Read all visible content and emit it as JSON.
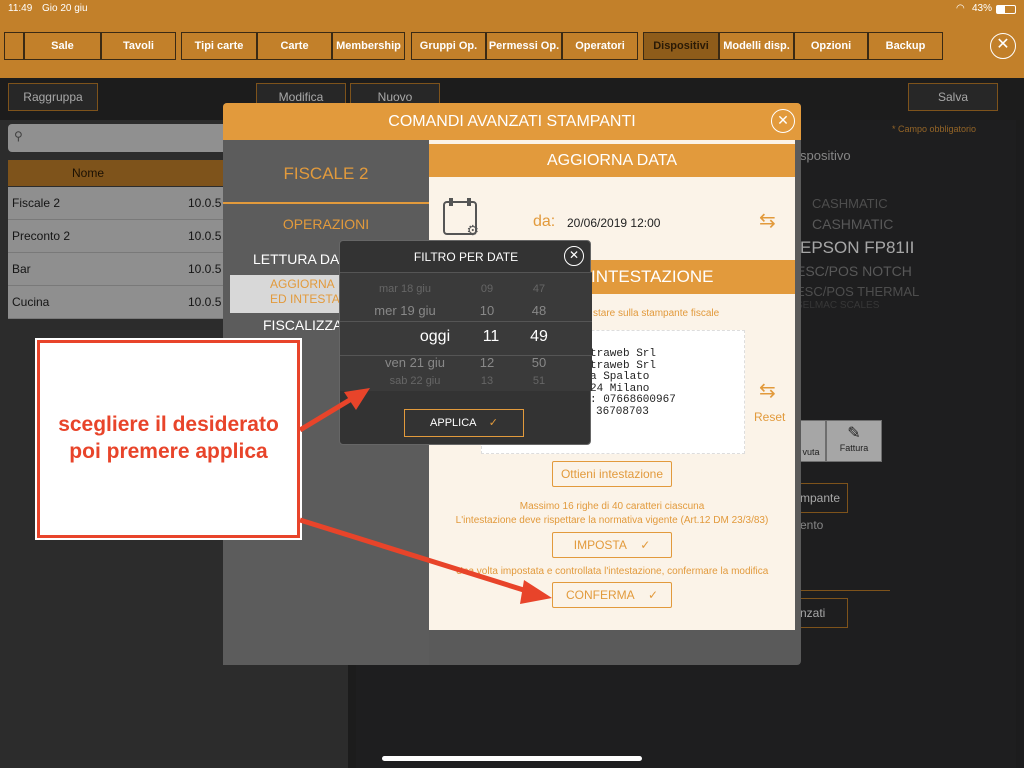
{
  "status": {
    "time": "11:49",
    "date": "Gio 20 giu",
    "battery": "43%"
  },
  "tabs": [
    "Sale",
    "Tavoli",
    "Tipi carte",
    "Carte",
    "Membership",
    "Gruppi Op.",
    "Permessi Op.",
    "Operatori",
    "Dispositivi",
    "Modelli disp.",
    "Opzioni",
    "Backup"
  ],
  "toolbar": {
    "group": "Raggruppa",
    "edit": "Modifica",
    "new": "Nuovo",
    "save": "Salva"
  },
  "list": {
    "header_name": "Nome",
    "rows": [
      {
        "name": "Fiscale 2",
        "ip": "10.0.5"
      },
      {
        "name": "Preconto 2",
        "ip": "10.0.5"
      },
      {
        "name": "Bar",
        "ip": "10.0.5"
      },
      {
        "name": "Cucina",
        "ip": "10.0.5"
      }
    ]
  },
  "right": {
    "required": "* Campo obbligatorio",
    "device_label": "spositivo",
    "models": [
      "CASHMATIC",
      "CASHMATIC",
      "EPSON FP81II",
      "ESC/POS NOTCH",
      "ESC/POS THERMAL",
      "SELMAC SCALES"
    ],
    "receipt_label": "vuta",
    "invoice_label": "Fattura",
    "printer_btn": "mpante",
    "fragment": "ento",
    "adv_btn": "nzati"
  },
  "modal": {
    "title": "COMANDI AVANZATI STAMPANTI",
    "device": "FISCALE 2",
    "operations": "OPERAZIONI",
    "menu": [
      "LETTURA DA",
      "AGGIORNA\nED INTESTA",
      "FISCALIZZA"
    ],
    "update_date_title": "AGGIORNA DATA",
    "from_label": "da:",
    "from_value": "20/06/2019 12:00",
    "header_title": "INTESTAZIONE",
    "header_hint": "stare sulla stampante fiscale",
    "receipt_lines": [
      "traweb Srl",
      "traweb Srl",
      "a Spalato",
      "24 Milano",
      ": 07668600967",
      "36708703"
    ],
    "reset": "Reset",
    "get_header": "Ottieni intestazione",
    "max_rows": "Massimo 16 righe di 40 caratteri ciascuna",
    "norm": "L'intestazione deve rispettare la normativa vigente (Art.12 DM 23/3/83)",
    "set_btn": "IMPOSTA",
    "confirm_hint": "Una volta impostata e controllata l'intestazione, confermare la modifica",
    "confirm_btn": "CONFERMA",
    "check": "✓"
  },
  "popup": {
    "title": "FILTRO PER DATE",
    "days": [
      "mar 18 giu",
      "mer 19 giu",
      "oggi",
      "ven 21 giu",
      "sab 22 giu"
    ],
    "hours": [
      "09",
      "10",
      "11",
      "12",
      "13"
    ],
    "minutes": [
      "47",
      "48",
      "49",
      "50",
      "51"
    ],
    "apply": "APPLICA"
  },
  "annotation": {
    "line1": "scegliere il desiderato",
    "line2": "poi premere applica"
  },
  "colors": {
    "accent": "#c2802a",
    "modal_accent": "#e29a3c",
    "annotation": "#e8442a"
  }
}
